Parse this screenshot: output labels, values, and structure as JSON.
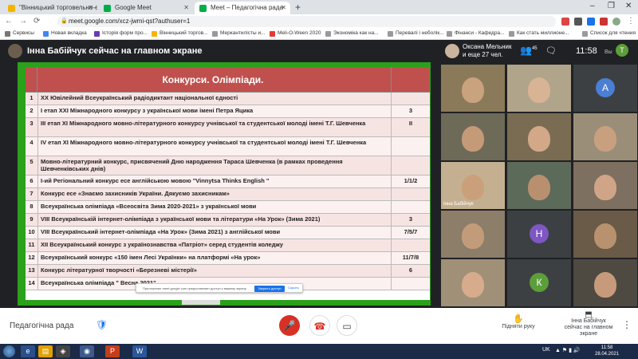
{
  "browser": {
    "tabs": [
      {
        "label": "\"Вінницький торговельно-еконо",
        "fav": "#f5b400",
        "active": false
      },
      {
        "label": "Google Meet",
        "fav": "#00ac47",
        "active": false
      },
      {
        "label": "Meet – Педагогічна рада",
        "fav": "#00ac47",
        "active": true
      }
    ],
    "new_tab": "+",
    "window_controls": [
      "–",
      "❐",
      "✕"
    ],
    "url": "meet.google.com/xcz-jwmi-qst?authuser=1",
    "bookmarks": [
      "Сервисы",
      "Новая вкладка",
      "Історія форм про...",
      "Вінницький торгов...",
      "Меркантилісты и...",
      "Meli-O-Ween 2020",
      "Экономіка как на...",
      "Перевалі і неболік...",
      "Фінанси - Кафедра...",
      "Как стать миллионе...",
      "Список для чтения"
    ]
  },
  "meet_header": {
    "presenter_text": "Інна Бабійчук сейчас на главном экране",
    "mini_name": "Оксана Мельник",
    "mini_more": "и еще 27 чел.",
    "people_count": "45",
    "time": "11:58",
    "you_label": "Вы",
    "avatar_letter": "Т"
  },
  "slide": {
    "title": "Конкурси. Олімпіади.",
    "rows": [
      {
        "num": "1",
        "text": "XX Ювілейний Всеукраїнський радіодиктант національної єдності",
        "val": ""
      },
      {
        "num": "2",
        "text": "І етап XXІ Міжнародного конкурсу з української мови імені Петра Яцика",
        "val": "3"
      },
      {
        "num": "3",
        "text": "ІІІ етап ХІ Міжнародного мовно-літературного конкурсу учнівської та студентської молоді імені Т.Г. Шевченка",
        "val": "ІІ"
      },
      {
        "num": "4",
        "text": "IV етап ХІ Міжнародного мовно-літературного конкурсу учнівської та студентської молоді імені Т.Г. Шевченка",
        "val": ""
      },
      {
        "num": "5",
        "text": "Мовно-літературний конкурс, присвячений Дню народження Тараса Шевченка (в рамках проведення Шевченківських днів)",
        "val": ""
      },
      {
        "num": "6",
        "text": "І-ий Регіональний конкурс есе англійською мовою \"Vinnytsa Thinks English \"",
        "val": "1/1/2"
      },
      {
        "num": "7",
        "text": "Конкурс есе «Знаємо захисників України. Дякуємо захисникам»",
        "val": ""
      },
      {
        "num": "8",
        "text": "Всеукраїнська олімпіада «Всеосвіта Зима 2020-2021» з української мови",
        "val": ""
      },
      {
        "num": "9",
        "text": "VIII Всеукраїнській інтернет-олімпіада з української мови та літератури «На Урок» (Зима 2021)",
        "val": "3"
      },
      {
        "num": "10",
        "text": "VIII Всеукраїнський інтернет-олімпіада «На Урок» (Зима 2021) з англійської мови",
        "val": "7/5/7"
      },
      {
        "num": "11",
        "text": "ХІІ Всеукраїнський конкурс з українознавства «Патріот» серед студентів коледжу",
        "val": ""
      },
      {
        "num": "12",
        "text": "Всеукраїнський конкурс «150 імен Лесі Українки» на платформі «На урок»",
        "val": "11/7/8"
      },
      {
        "num": "13",
        "text": "Конкурс літературної творчості «Березневі містерії»",
        "val": "6"
      },
      {
        "num": "14",
        "text": "Всеукраїнська олімпіада \" Весна 2021\"",
        "val": ""
      }
    ],
    "notice_text": "Приложение meet.google.com предоставляет доступ к вашему экрану.",
    "notice_stop": "Закрыть доступ",
    "notice_hide": "Скрыть"
  },
  "participants": [
    {
      "type": "video",
      "name": ""
    },
    {
      "type": "video",
      "name": ""
    },
    {
      "type": "letter",
      "letter": "A",
      "color": "#4a7fd4"
    },
    {
      "type": "video",
      "name": ""
    },
    {
      "type": "video",
      "name": ""
    },
    {
      "type": "video",
      "name": ""
    },
    {
      "type": "video",
      "name": "Інна Бабійчук"
    },
    {
      "type": "video",
      "name": ""
    },
    {
      "type": "video",
      "name": ""
    },
    {
      "type": "video",
      "name": ""
    },
    {
      "type": "letter",
      "letter": "Н",
      "color": "#7e57c2"
    },
    {
      "type": "video",
      "name": ""
    },
    {
      "type": "video",
      "name": ""
    },
    {
      "type": "letter",
      "letter": "К",
      "color": "#5c9e3a"
    },
    {
      "type": "video",
      "name": ""
    }
  ],
  "bottom_bar": {
    "meeting_name": "Педагогічна рада",
    "raise_hand": "Підняти руку",
    "present_line1": "Інна Бабійчук",
    "present_line2": "сейчас на главном экране"
  },
  "taskbar": {
    "lang": "UK",
    "time": "11:58",
    "date": "28.04.2021"
  }
}
